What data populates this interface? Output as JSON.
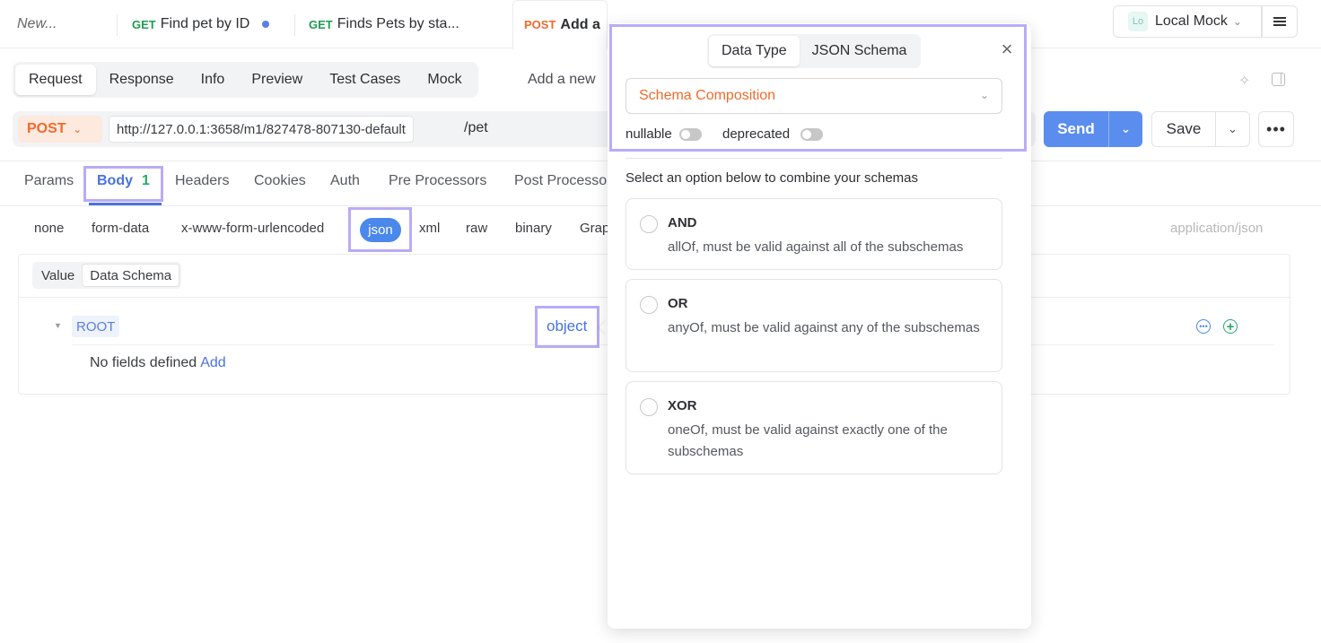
{
  "tabs": {
    "new_label": "New...",
    "items": [
      {
        "method": "GET",
        "name": "Find pet by ID"
      },
      {
        "method": "GET",
        "name": "Finds Pets by sta..."
      },
      {
        "method": "POST",
        "name": "Add a"
      }
    ]
  },
  "environment": {
    "badge": "Lo",
    "label": "Local Mock"
  },
  "request_tabs": [
    "Request",
    "Response",
    "Info",
    "Preview",
    "Test Cases",
    "Mock"
  ],
  "add_new_text": "Add a new",
  "url": {
    "method": "POST",
    "base": "http://127.0.0.1:3658/m1/827478-807130-default",
    "path": "/pet"
  },
  "buttons": {
    "send": "Send",
    "save": "Save"
  },
  "param_tabs": {
    "params": "Params",
    "body": "Body",
    "body_count": "1",
    "headers": "Headers",
    "cookies": "Cookies",
    "auth": "Auth",
    "pre": "Pre Processors",
    "post": "Post Processo"
  },
  "body_types": {
    "none": "none",
    "form_data": "form-data",
    "urlencoded": "x-www-form-urlencoded",
    "json": "json",
    "xml": "xml",
    "raw": "raw",
    "binary": "binary",
    "graphql": "Grap",
    "content_type": "application/json"
  },
  "schema_view": {
    "value": "Value",
    "data_schema": "Data Schema"
  },
  "root": {
    "label": "ROOT",
    "type": "object"
  },
  "no_fields": {
    "text": "No fields defined",
    "add": "Add"
  },
  "popover": {
    "tabs": {
      "data_type": "Data Type",
      "json_schema": "JSON Schema"
    },
    "select_value": "Schema Composition",
    "nullable": "nullable",
    "deprecated": "deprecated",
    "hint": "Select an option below to combine your schemas",
    "options": [
      {
        "title": "AND",
        "desc": "allOf, must be valid against all of the subschemas"
      },
      {
        "title": "OR",
        "desc": "anyOf, must be valid against any of the subschemas"
      },
      {
        "title": "XOR",
        "desc": "oneOf, must be valid against exactly one of the subschemas"
      }
    ]
  },
  "colors": {
    "accent": "#4a72e0",
    "post": "#ef6b2c",
    "get": "#1f9d55",
    "highlight": "#b8acf6",
    "send": "#5b8def"
  }
}
